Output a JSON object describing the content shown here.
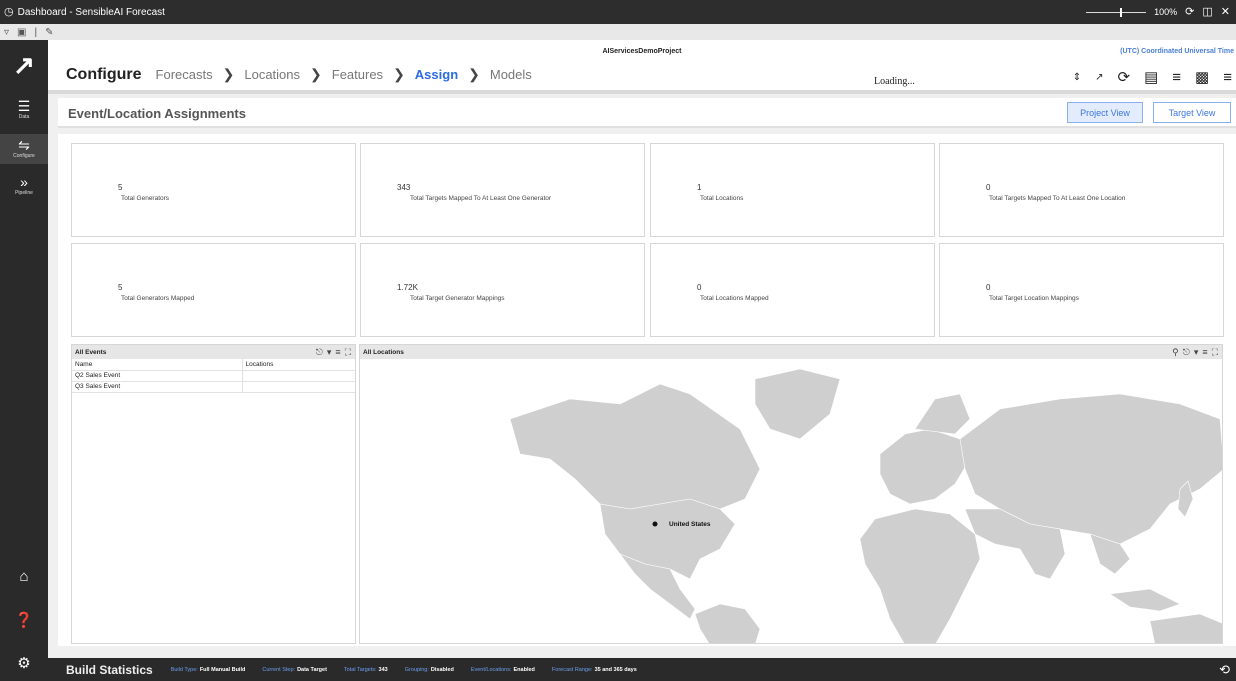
{
  "window": {
    "title": "Dashboard - SensibleAI Forecast",
    "zoom_label": "100%"
  },
  "sidebar": {
    "items": [
      {
        "label": "Data",
        "icon": "database-icon"
      },
      {
        "label": "Configure",
        "icon": "sliders-icon"
      },
      {
        "label": "Pipeline",
        "icon": "chevrons-right-icon"
      }
    ],
    "bottom_icons": [
      "home-icon",
      "help-icon",
      "account-settings-icon"
    ]
  },
  "header": {
    "project": "AIServicesDemoProject",
    "timezone": "(UTC) Coordinated Universal Time",
    "breadcrumb": {
      "title": "Configure",
      "steps": [
        "Forecasts",
        "Locations",
        "Features",
        "Assign",
        "Models"
      ],
      "active_step": "Assign"
    },
    "loading_text": "Loading..."
  },
  "section": {
    "title": "Event/Location Assignments",
    "project_view_label": "Project View",
    "target_view_label": "Target View"
  },
  "kpis": [
    {
      "value": "5",
      "label": "Total Generators"
    },
    {
      "value": "343",
      "label": "Total Targets Mapped To At Least One Generator"
    },
    {
      "value": "1",
      "label": "Total Locations"
    },
    {
      "value": "0",
      "label": "Total Targets Mapped To At Least One Location"
    },
    {
      "value": "5",
      "label": "Total Generators Mapped"
    },
    {
      "value": "1.72K",
      "label": "Total Target Generator Mappings"
    },
    {
      "value": "0",
      "label": "Total Locations Mapped"
    },
    {
      "value": "0",
      "label": "Total Target Location Mappings"
    }
  ],
  "events_panel": {
    "title": "All Events",
    "columns": [
      "Name",
      "Locations"
    ],
    "rows": [
      {
        "name": "Q2 Sales Event",
        "locations": ""
      },
      {
        "name": "Q3 Sales Event",
        "locations": ""
      }
    ]
  },
  "map_panel": {
    "title": "All Locations",
    "marker_label": "United States"
  },
  "status_bar": {
    "title": "Build Statistics",
    "items": [
      {
        "key": "Build Type:",
        "value": "Full Manual Build"
      },
      {
        "key": "Current Step:",
        "value": "Data Target"
      },
      {
        "key": "Total Targets:",
        "value": "343"
      },
      {
        "key": "Grouping:",
        "value": "Disabled"
      },
      {
        "key": "Event/Locations:",
        "value": "Enabled"
      },
      {
        "key": "Forecast Range:",
        "value": "35 and 365 days"
      }
    ]
  },
  "colors": {
    "accent": "#2b6de0",
    "sidebar": "#2a2a2a",
    "map_land": "#cfcfcf"
  }
}
